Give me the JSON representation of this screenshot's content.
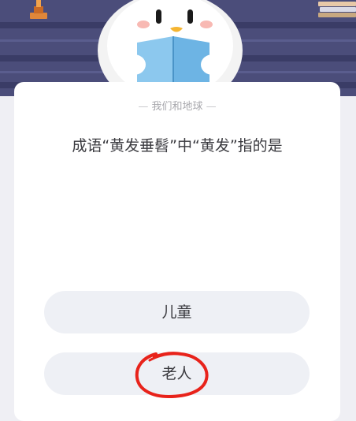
{
  "quiz": {
    "category": "我们和地球",
    "category_dash_left": "—",
    "category_dash_right": "—",
    "question": "成语“黄发垂髫”中“黄发”指的是",
    "options": [
      {
        "label": "儿童"
      },
      {
        "label": "老人"
      }
    ]
  },
  "annotations": {
    "marked_option_index": 1,
    "mark_color": "#e8231b"
  },
  "colors": {
    "banner": "#4b4d7a",
    "page_bg": "#efeff4",
    "option_bg": "#eef0f5",
    "text": "#3a3a3f"
  },
  "icons": [
    "penguin-mascot-icon",
    "trophy-icon",
    "books-icon"
  ]
}
